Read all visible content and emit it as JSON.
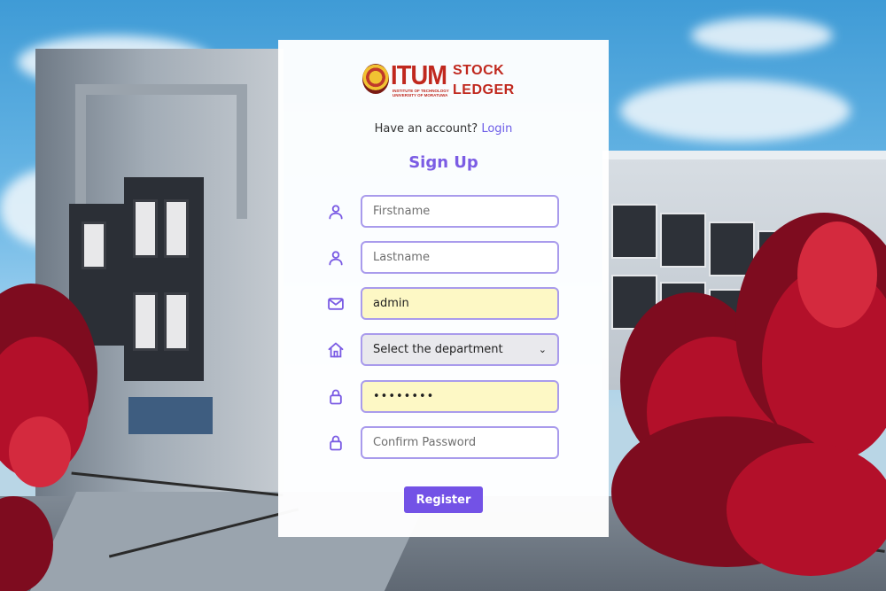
{
  "logo": {
    "brand": "ITUM",
    "subtitle": "INSTITUTE OF TECHNOLOGY UNIVERSITY OF MORATUWA",
    "app_line1": "STOCK",
    "app_line2": "LEDGER"
  },
  "account_prompt": "Have an account?",
  "login_link": "Login",
  "title": "Sign Up",
  "fields": {
    "firstname": {
      "placeholder": "Firstname",
      "value": ""
    },
    "lastname": {
      "placeholder": "Lastname",
      "value": ""
    },
    "email": {
      "placeholder": "",
      "value": "admin"
    },
    "department": {
      "selected": "Select the department"
    },
    "password": {
      "value": "••••••••"
    },
    "confirm_password": {
      "placeholder": "Confirm Password",
      "value": ""
    }
  },
  "register_label": "Register",
  "colors": {
    "accent": "#7352e6",
    "heading": "#7b5ce4",
    "field_border": "#a99bec",
    "autofill_bg": "#fdf8c5",
    "brand_red": "#c0281e"
  },
  "icons": [
    "user-icon",
    "user-icon",
    "envelope-icon",
    "home-icon",
    "lock-icon",
    "lock-icon"
  ]
}
